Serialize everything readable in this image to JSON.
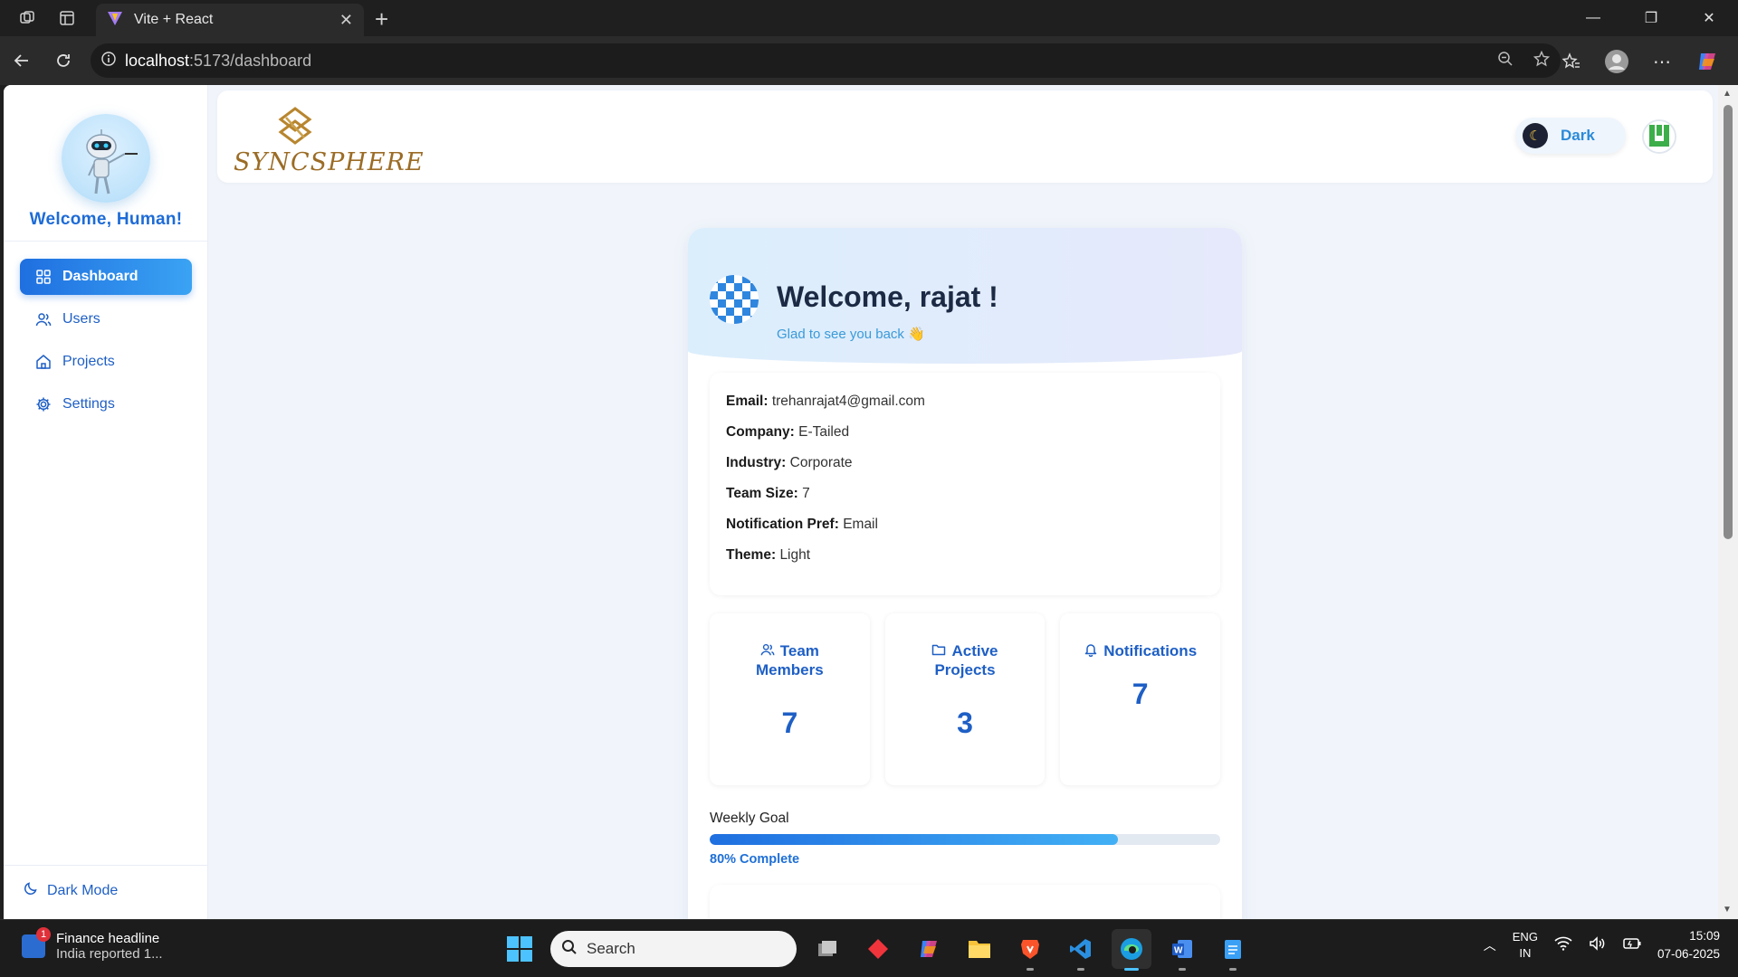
{
  "browser": {
    "tab_title": "Vite + React",
    "url_host": "localhost",
    "url_path": ":5173/dashboard"
  },
  "sidebar": {
    "welcome": "Welcome, Human!",
    "items": [
      {
        "label": "Dashboard",
        "icon": "grid-icon",
        "active": true
      },
      {
        "label": "Users",
        "icon": "users-icon",
        "active": false
      },
      {
        "label": "Projects",
        "icon": "home-icon",
        "active": false
      },
      {
        "label": "Settings",
        "icon": "gear-icon",
        "active": false
      }
    ],
    "dark_mode_label": "Dark Mode"
  },
  "header": {
    "logo_text": "SYNCSPHERE",
    "theme_toggle_label": "Dark"
  },
  "profile": {
    "greeting": "Welcome, rajat !",
    "subtitle": "Glad to see you back 👋",
    "fields": [
      {
        "label": "Email:",
        "value": "trehanrajat4@gmail.com"
      },
      {
        "label": "Company:",
        "value": "E-Tailed"
      },
      {
        "label": "Industry:",
        "value": "Corporate"
      },
      {
        "label": "Team Size:",
        "value": "7"
      },
      {
        "label": "Notification Pref:",
        "value": "Email"
      },
      {
        "label": "Theme:",
        "value": "Light"
      }
    ],
    "stats": [
      {
        "title_line1": "Team",
        "title_line2": "Members",
        "value": "7",
        "icon": "users-icon"
      },
      {
        "title_line1": "Active",
        "title_line2": "Projects",
        "value": "3",
        "icon": "folder-icon"
      },
      {
        "title_line1": "Notifications",
        "title_line2": "",
        "value": "7",
        "icon": "bell-icon"
      }
    ],
    "goal": {
      "label": "Weekly Goal",
      "progress": 0.8,
      "status": "80% Complete"
    }
  },
  "taskbar": {
    "news_badge": "1",
    "news_title": "Finance headline",
    "news_sub": "India reported 1...",
    "search_placeholder": "Search",
    "lang_line1": "ENG",
    "lang_line2": "IN",
    "time": "15:09",
    "date": "07-06-2025"
  },
  "colors": {
    "primary": "#1e5fc5",
    "accent": "#3aa3f3",
    "logo_gold": "#9b6c25"
  }
}
